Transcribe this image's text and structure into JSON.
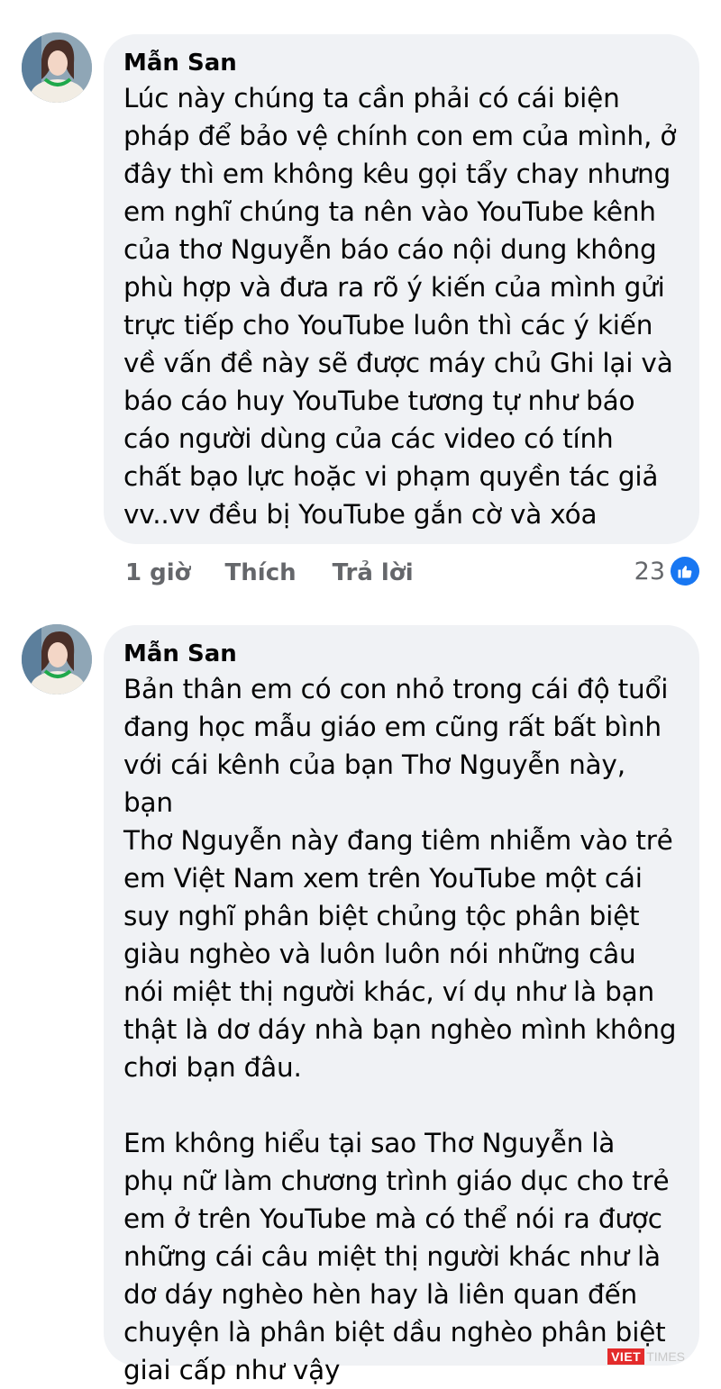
{
  "comments": [
    {
      "author": "Mẫn San",
      "text": "Lúc này chúng ta cần phải có cái biện\npháp để bảo vệ chính con em của mình, ở\nđây thì em không kêu gọi tẩy chay nhưng\nem nghĩ chúng ta nên vào YouTube kênh\ncủa thơ Nguyễn báo cáo nội dung không\nphù hợp và đưa ra rõ ý kiến của mình gửi\ntrực tiếp cho YouTube luôn thì các ý kiến\nvề vấn đề này sẽ được máy chủ Ghi lại và\nbáo cáo huy YouTube tương tự như báo\ncáo người dùng của các video có tính\nchất bạo lực hoặc vi phạm quyền tác giả\nvv..vv đều bị YouTube gắn cờ và xóa",
      "time": "1 giờ",
      "like_label": "Thích",
      "reply_label": "Trả lời",
      "reaction_count": "23",
      "reaction_icon": "like-icon"
    },
    {
      "author": "Mẫn San",
      "text": "Bản thân em có con nhỏ trong cái độ tuổi\nđang học mẫu giáo em cũng rất bất bình\nvới cái kênh của bạn Thơ Nguyễn này, bạn\nThơ Nguyễn này đang tiêm nhiễm vào trẻ\nem Việt Nam xem trên YouTube  một cái\nsuy nghĩ phân biệt chủng tộc phân biệt\ngiàu nghèo và luôn luôn nói những câu\nnói miệt thị người khác, ví dụ như là bạn\nthật là dơ dáy nhà bạn nghèo mình không\nchơi bạn đâu.\n\nEm không hiểu tại sao Thơ Nguyễn là\nphụ nữ làm chương trình giáo dục cho trẻ\nem ở trên YouTube mà có thể nói ra được\nnhững cái câu miệt thị người khác như là\ndơ dáy nghèo hèn hay là liên quan đến\nchuyện là phân biệt dầu nghèo phân biệt\ngiai cấp như vậy"
    }
  ],
  "watermark": {
    "brand": "VIET",
    "suffix": "TIMES"
  },
  "colors": {
    "like_badge": "#1877f2",
    "bubble": "#f0f2f5",
    "meta_text": "#65676b",
    "watermark": "#e32b2b"
  }
}
